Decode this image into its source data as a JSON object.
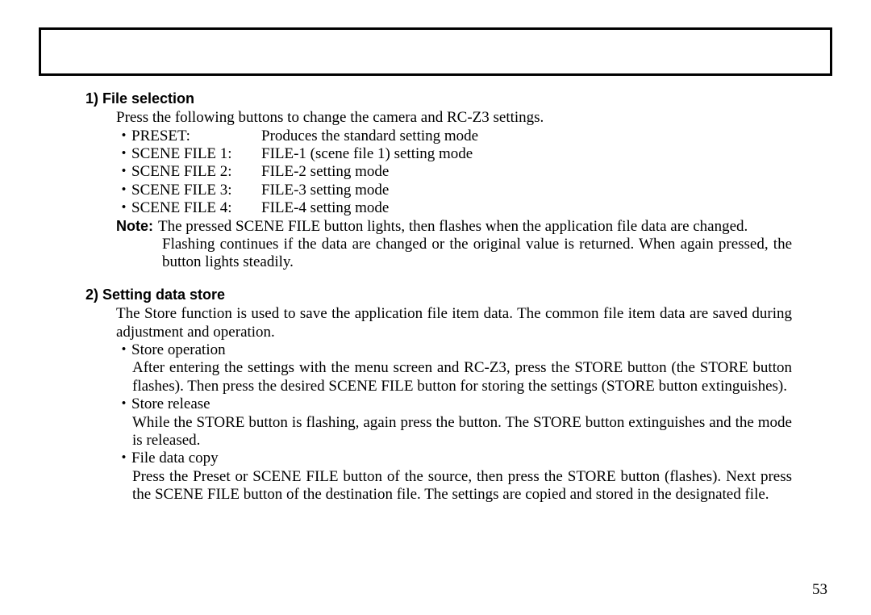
{
  "section1": {
    "heading": "1) File selection",
    "intro": "Press the following buttons to change the camera and RC-Z3 settings.",
    "items": [
      {
        "label": "・PRESET:",
        "desc": "Produces the standard setting mode"
      },
      {
        "label": "・SCENE FILE 1:",
        "desc": "FILE-1 (scene file 1) setting mode"
      },
      {
        "label": "・SCENE FILE 2:",
        "desc": "FILE-2 setting mode"
      },
      {
        "label": "・SCENE FILE 3:",
        "desc": "FILE-3 setting mode"
      },
      {
        "label": "・SCENE FILE 4:",
        "desc": "FILE-4 setting mode"
      }
    ],
    "note_label": "Note:",
    "note_line1": "The pressed SCENE FILE button lights, then flashes when the application file data are changed.",
    "note_line2": "Flashing continues if the data are changed or the original value is returned.   When again pressed, the button lights steadily."
  },
  "section2": {
    "heading": "2) Setting data store",
    "intro": "The Store function is used to save the application file item data.   The common file item data are saved during adjustment and operation.",
    "items": [
      {
        "label": "・Store operation",
        "body": "After entering the settings with the menu screen and RC-Z3, press the STORE button (the STORE button flashes).  Then press the desired SCENE FILE button for storing the settings (STORE button extinguishes)."
      },
      {
        "label": "・Store release",
        "body": "While the STORE button is flashing, again press the button. The STORE button extinguishes and the mode is released."
      },
      {
        "label": "・File data copy",
        "body": "Press the Preset or SCENE FILE button of the source, then press the STORE button (flashes).  Next press the SCENE FILE button of the destination file.   The settings are copied and stored in the designated file."
      }
    ]
  },
  "page_number": "53"
}
